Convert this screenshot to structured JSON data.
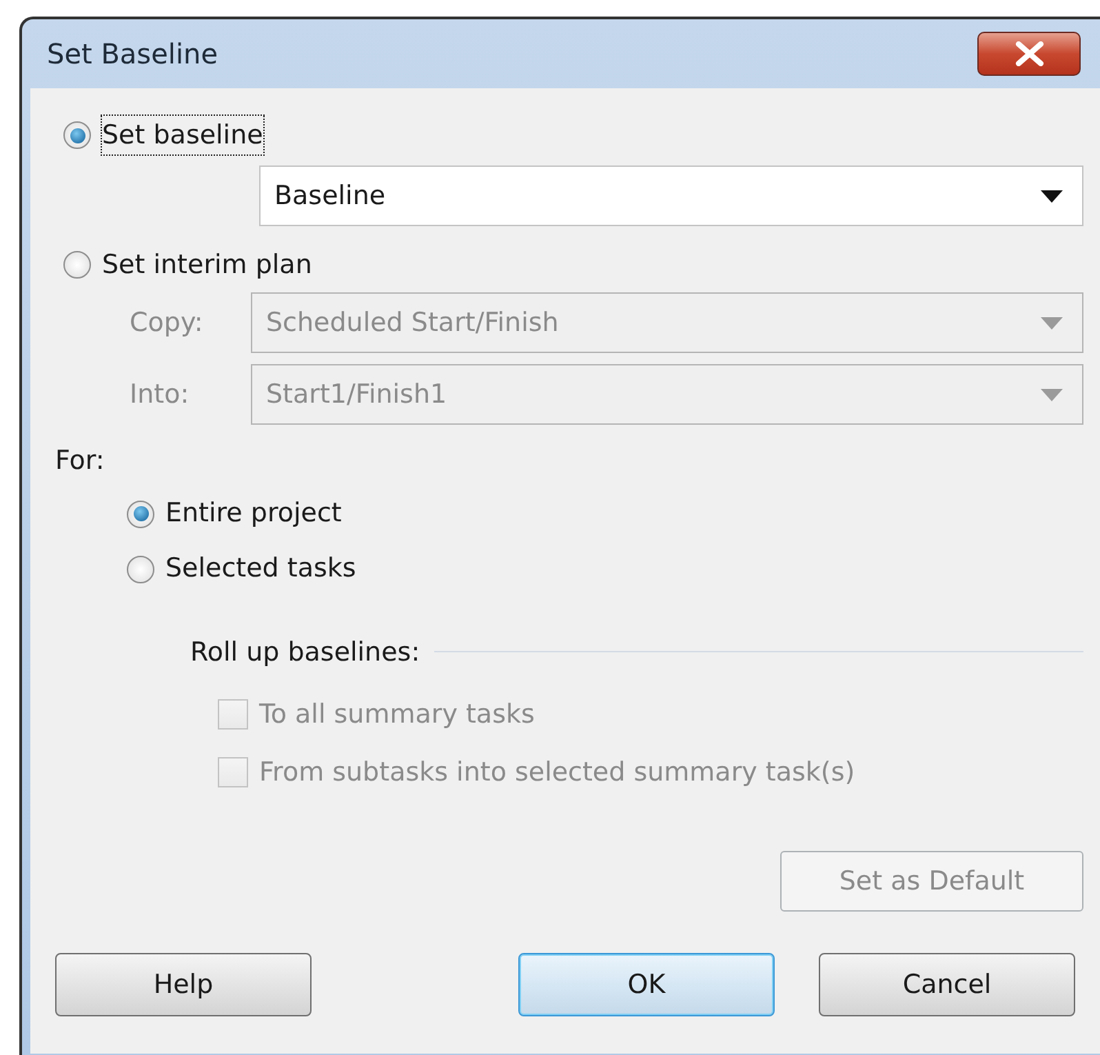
{
  "window": {
    "title": "Set Baseline"
  },
  "mode_options": [
    {
      "label": "Set baseline",
      "selected": true,
      "focused": true
    },
    {
      "label": "Set interim plan",
      "selected": false,
      "focused": false
    }
  ],
  "baseline_select": {
    "value": "Baseline",
    "disabled": false
  },
  "interim_fields": [
    {
      "label": "Copy:",
      "value": "Scheduled Start/Finish",
      "disabled": true
    },
    {
      "label": "Into:",
      "value": "Start1/Finish1",
      "disabled": true
    }
  ],
  "scope": {
    "label": "For:",
    "options": [
      {
        "label": "Entire project",
        "selected": true
      },
      {
        "label": "Selected tasks",
        "selected": false
      }
    ]
  },
  "roll_up": {
    "label": "Roll up baselines:",
    "options": [
      {
        "label": "To all summary tasks",
        "checked": false,
        "disabled": true
      },
      {
        "label": "From subtasks into selected summary task(s)",
        "checked": false,
        "disabled": true
      }
    ]
  },
  "set_default_button": {
    "label": "Set as Default",
    "disabled": true
  },
  "buttons": [
    {
      "label": "Help",
      "default": false
    },
    {
      "label": "OK",
      "default": true
    },
    {
      "label": "Cancel",
      "default": false
    }
  ]
}
